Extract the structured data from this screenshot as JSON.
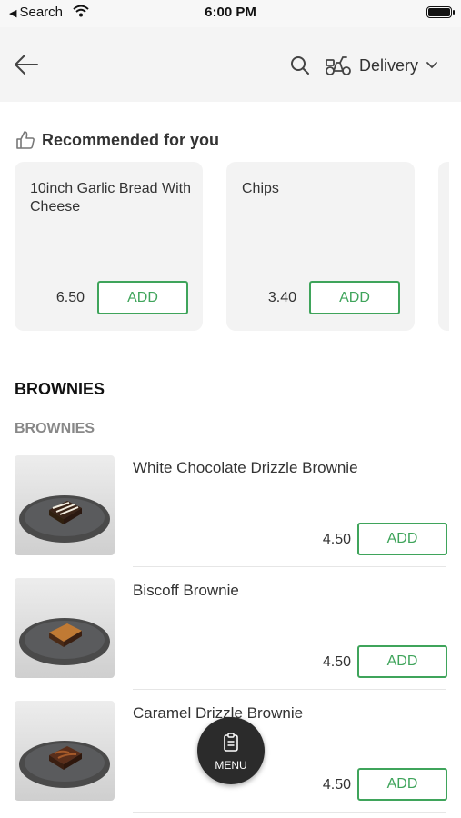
{
  "status_bar": {
    "back_label": "Search",
    "time": "6:00 PM"
  },
  "header": {
    "order_mode": "Delivery"
  },
  "recommended": {
    "title": "Recommended for you",
    "items": [
      {
        "name": "10inch Garlic Bread With Cheese",
        "price": "6.50",
        "add_label": "ADD"
      },
      {
        "name": "Chips",
        "price": "3.40",
        "add_label": "ADD"
      }
    ]
  },
  "category": {
    "title": "BROWNIES",
    "subcategory": "BROWNIES",
    "items": [
      {
        "name": "White Chocolate Drizzle Brownie",
        "price": "4.50",
        "add_label": "ADD"
      },
      {
        "name": "Biscoff Brownie",
        "price": "4.50",
        "add_label": "ADD"
      },
      {
        "name": "Caramel Drizzle Brownie",
        "price": "4.50",
        "add_label": "ADD"
      }
    ]
  },
  "menu_button": {
    "label": "MENU"
  },
  "colors": {
    "accent": "#3fa45b",
    "header_bg": "#f4f4f4",
    "card_bg": "#f3f3f3",
    "fab_bg": "#2b2b2b"
  },
  "icons": [
    "back-arrow-icon",
    "search-icon",
    "delivery-scooter-icon",
    "chevron-down-icon",
    "thumbs-up-icon",
    "menu-icon",
    "wifi-icon",
    "battery-icon"
  ]
}
